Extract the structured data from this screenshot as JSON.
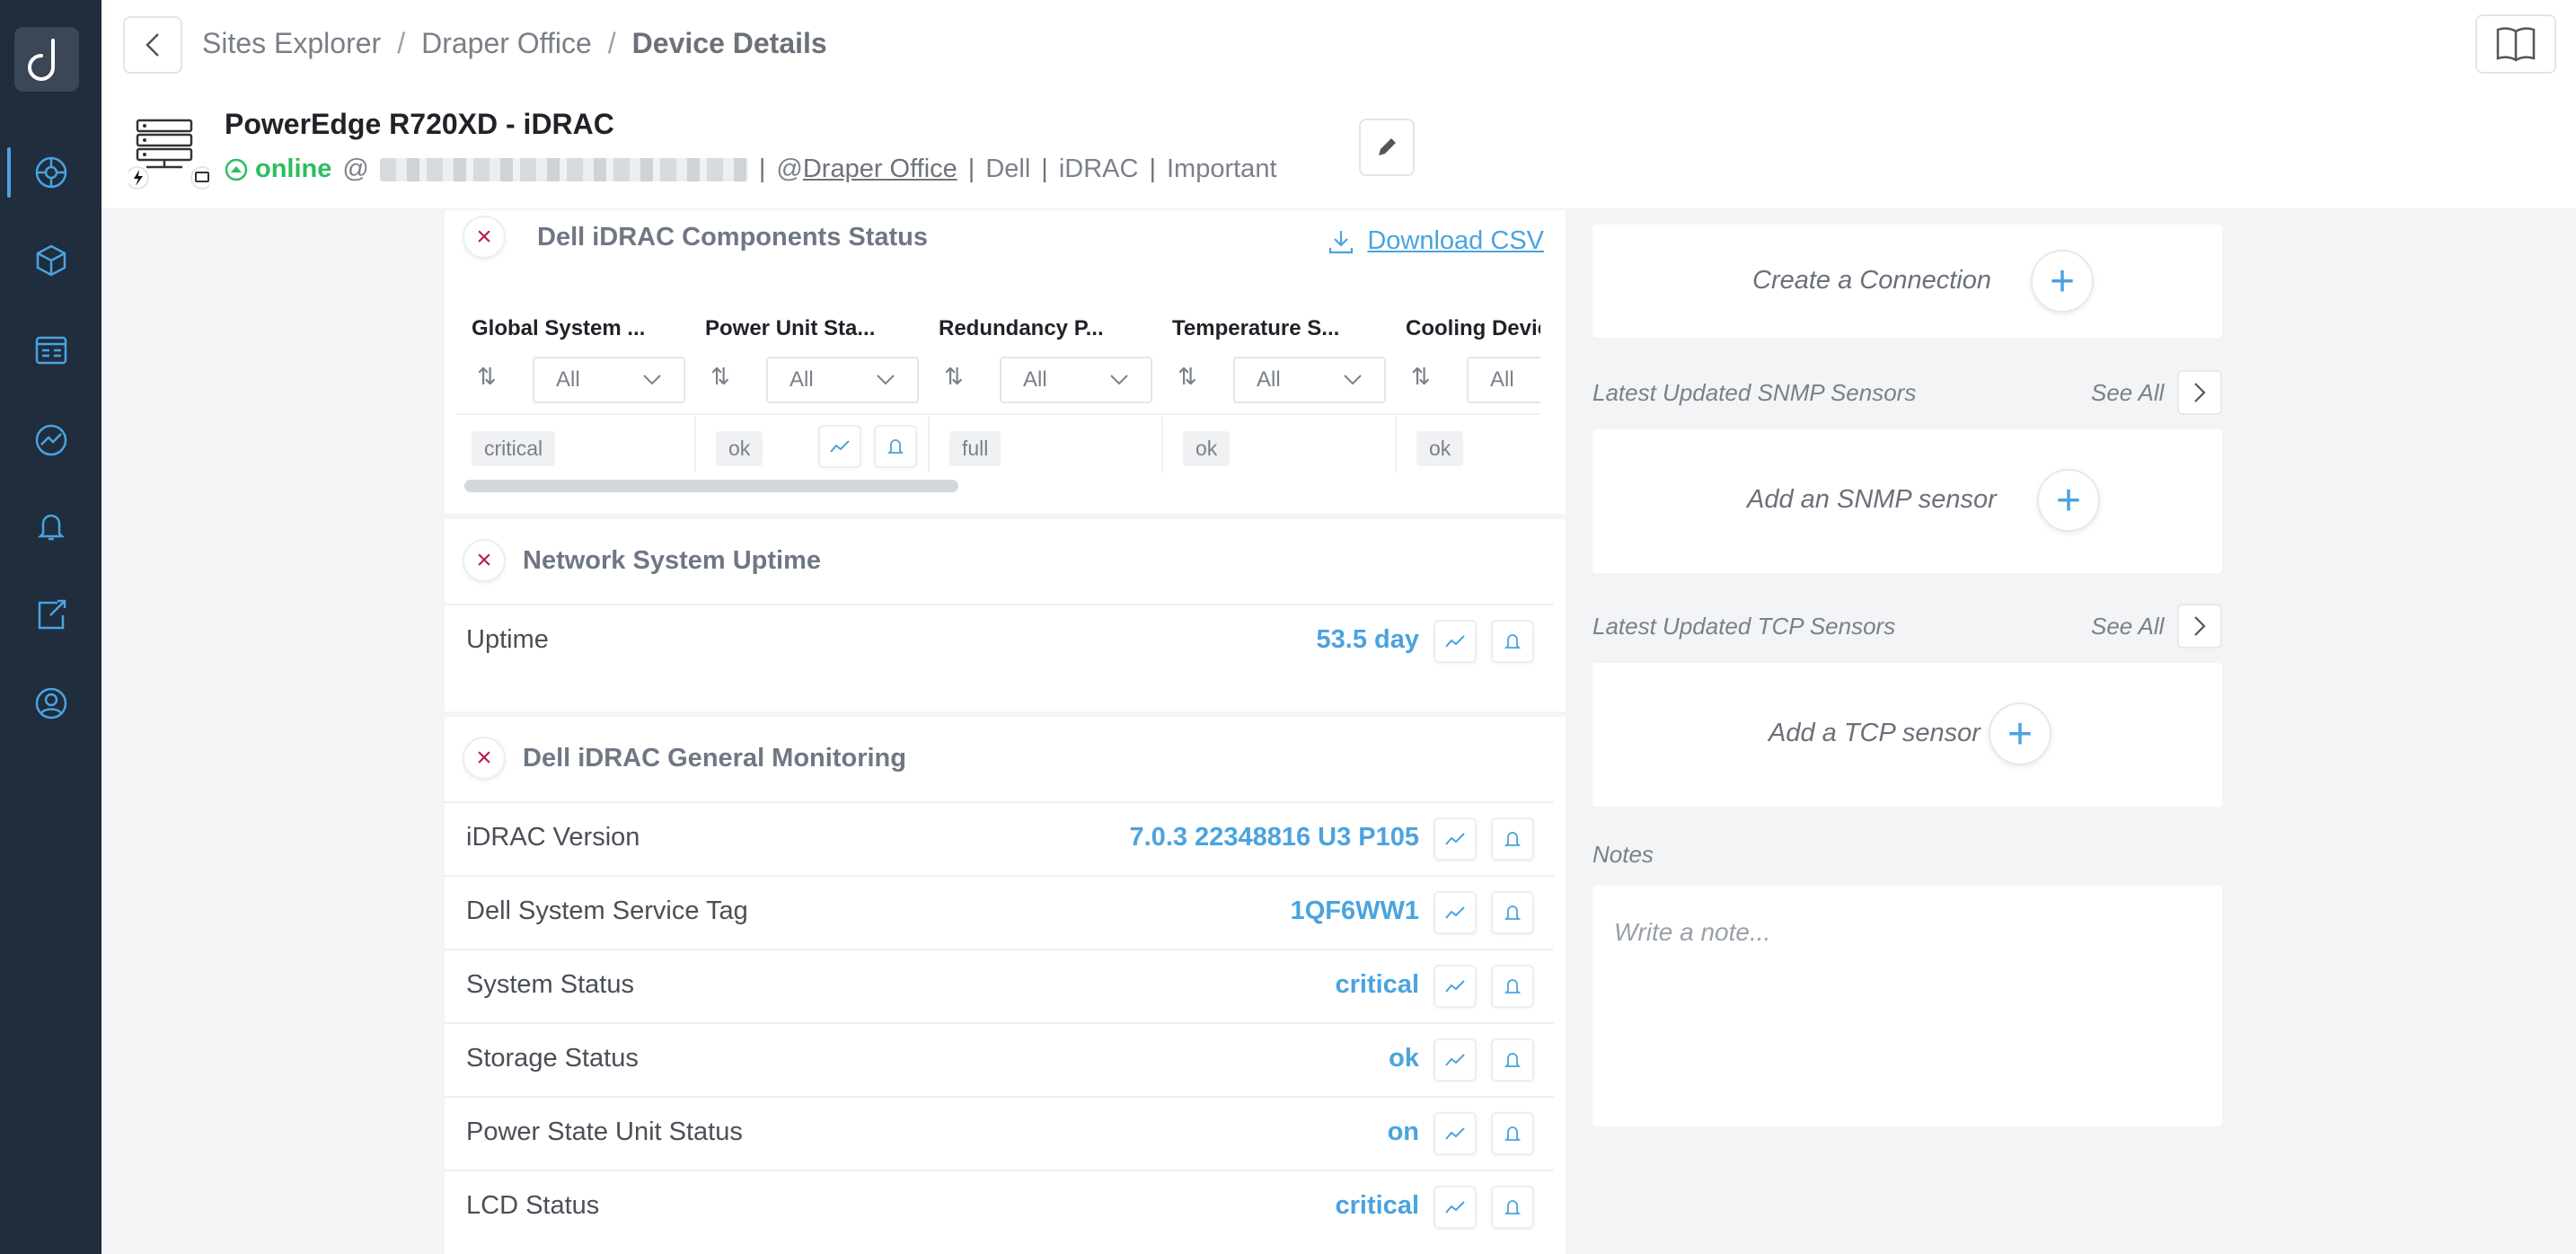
{
  "breadcrumbs": [
    "Sites Explorer",
    "Draper Office",
    "Device Details"
  ],
  "device": {
    "title": "PowerEdge R720XD - iDRAC",
    "status": "online",
    "at": "@",
    "site_prefix": "@",
    "site": "Draper Office",
    "tags": [
      "Dell",
      "iDRAC",
      "Important"
    ]
  },
  "components": {
    "title": "Dell iDRAC Components Status",
    "download_label": "Download CSV",
    "columns": [
      {
        "header": "Global System ...",
        "filter": "All",
        "value": "critical"
      },
      {
        "header": "Power Unit Sta...",
        "filter": "All",
        "value": "ok"
      },
      {
        "header": "Redundancy P...",
        "filter": "All",
        "value": "full"
      },
      {
        "header": "Temperature S...",
        "filter": "All",
        "value": "ok"
      },
      {
        "header": "Cooling Devic",
        "filter": "All",
        "value": "ok"
      }
    ]
  },
  "uptime": {
    "title": "Network System Uptime",
    "label": "Uptime",
    "value": "53.5 day"
  },
  "general": {
    "title": "Dell iDRAC General Monitoring",
    "rows": [
      {
        "label": "iDRAC Version",
        "value": "7.0.3 22348816 U3 P105"
      },
      {
        "label": "Dell System Service Tag",
        "value": "1QF6WW1"
      },
      {
        "label": "System Status",
        "value": "critical"
      },
      {
        "label": "Storage Status",
        "value": "ok"
      },
      {
        "label": "Power State Unit Status",
        "value": "on"
      },
      {
        "label": "LCD Status",
        "value": "critical"
      }
    ]
  },
  "right": {
    "connection_label": "Create a Connection",
    "snmp_section": "Latest Updated SNMP Sensors",
    "snmp_add": "Add an SNMP sensor",
    "tcp_section": "Latest Updated TCP Sensors",
    "tcp_add": "Add a TCP sensor",
    "see_all": "See All",
    "notes_label": "Notes",
    "notes_placeholder": "Write a note..."
  },
  "colors": {
    "sidebar": "#1f2d3d",
    "accent": "#4aa3df",
    "online": "#2ebd5c",
    "close": "#c2185b"
  }
}
